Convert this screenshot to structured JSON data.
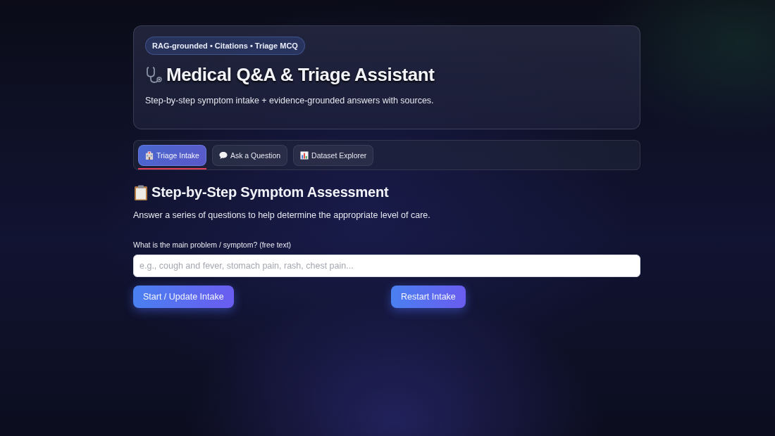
{
  "header": {
    "badge": "RAG-grounded • Citations • Triage MCQ",
    "title": "Medical Q&A & Triage Assistant",
    "subtitle": "Step-by-step symptom intake + evidence-grounded answers with sources."
  },
  "tabs": [
    {
      "label": "Triage Intake",
      "selected": true
    },
    {
      "label": "Ask a Question",
      "selected": false
    },
    {
      "label": "Dataset Explorer",
      "selected": false
    }
  ],
  "panel": {
    "heading": "Step-by-Step Symptom Assessment",
    "description": "Answer a series of questions to help determine the appropriate level of care.",
    "field": {
      "label": "What is the main problem / symptom? (free text)",
      "placeholder": "e.g., cough and fever, stomach pain, rash, chest pain..."
    },
    "buttons": [
      "Start / Update Intake",
      "Restart Intake"
    ]
  }
}
